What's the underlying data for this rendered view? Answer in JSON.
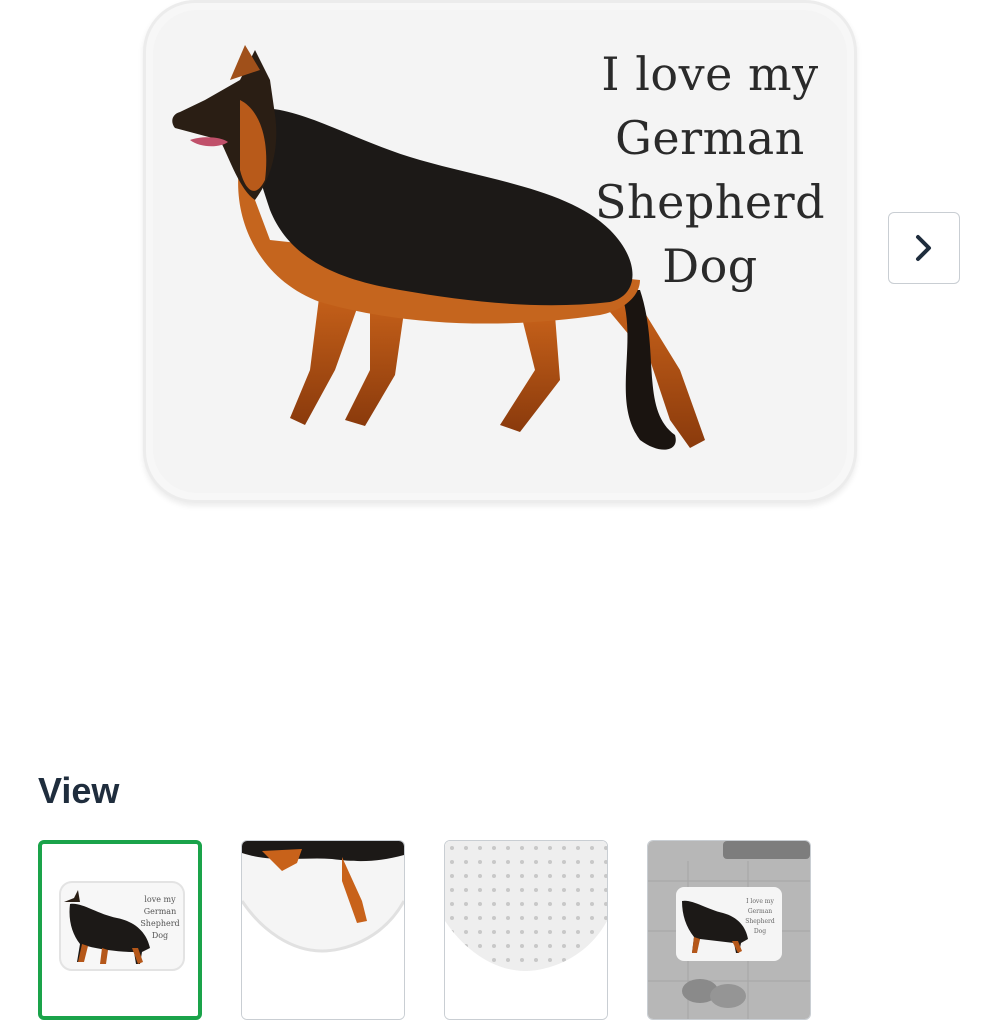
{
  "product_image": {
    "mat_text_lines": [
      "I love my",
      "German",
      "Shepherd",
      "Dog"
    ]
  },
  "gallery": {
    "next_icon": "chevron-right-icon"
  },
  "view_section": {
    "title": "View",
    "thumbnails": [
      {
        "name": "front-view",
        "selected": true
      },
      {
        "name": "corner-closeup",
        "selected": false
      },
      {
        "name": "back-view",
        "selected": false
      },
      {
        "name": "bathroom-scene",
        "selected": false
      }
    ]
  },
  "colors": {
    "selected_border": "#1aa34a",
    "heading": "#1f2d3d",
    "mat_background": "#f7f7f7"
  }
}
